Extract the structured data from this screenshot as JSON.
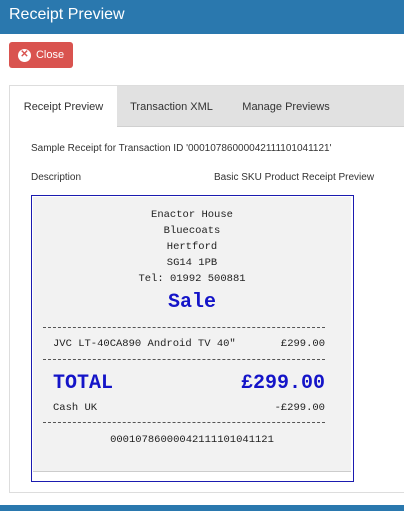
{
  "window": {
    "title": "Receipt Preview"
  },
  "toolbar": {
    "close_label": "Close",
    "close_icon": "x-circle-icon"
  },
  "tabs": [
    {
      "label": "Receipt Preview",
      "active": true
    },
    {
      "label": "Transaction XML",
      "active": false
    },
    {
      "label": "Manage Previews",
      "active": false
    }
  ],
  "content": {
    "sample_text": "Sample Receipt for Transaction ID '0001078600004211110104 1121'",
    "description_label": "Description",
    "description_value": "Basic SKU Product Receipt Preview"
  },
  "receipt": {
    "header_lines": [
      "Enactor House",
      "Bluecoats",
      "Hertford",
      "SG14 1PB",
      "Tel: 01992 500881"
    ],
    "sale_title": "Sale",
    "item": {
      "name": "JVC LT-40CA890 Android TV 40\"",
      "price": "£299.00"
    },
    "total_label": "TOTAL",
    "total_value": "£299.00",
    "payment": {
      "name": "Cash UK",
      "amount": "-£299.00"
    },
    "transaction_id": "000107860000421111010411 21"
  },
  "colors": {
    "brand": "#2a78ae",
    "danger": "#d9534f",
    "receipt_accent": "#1414c8"
  }
}
